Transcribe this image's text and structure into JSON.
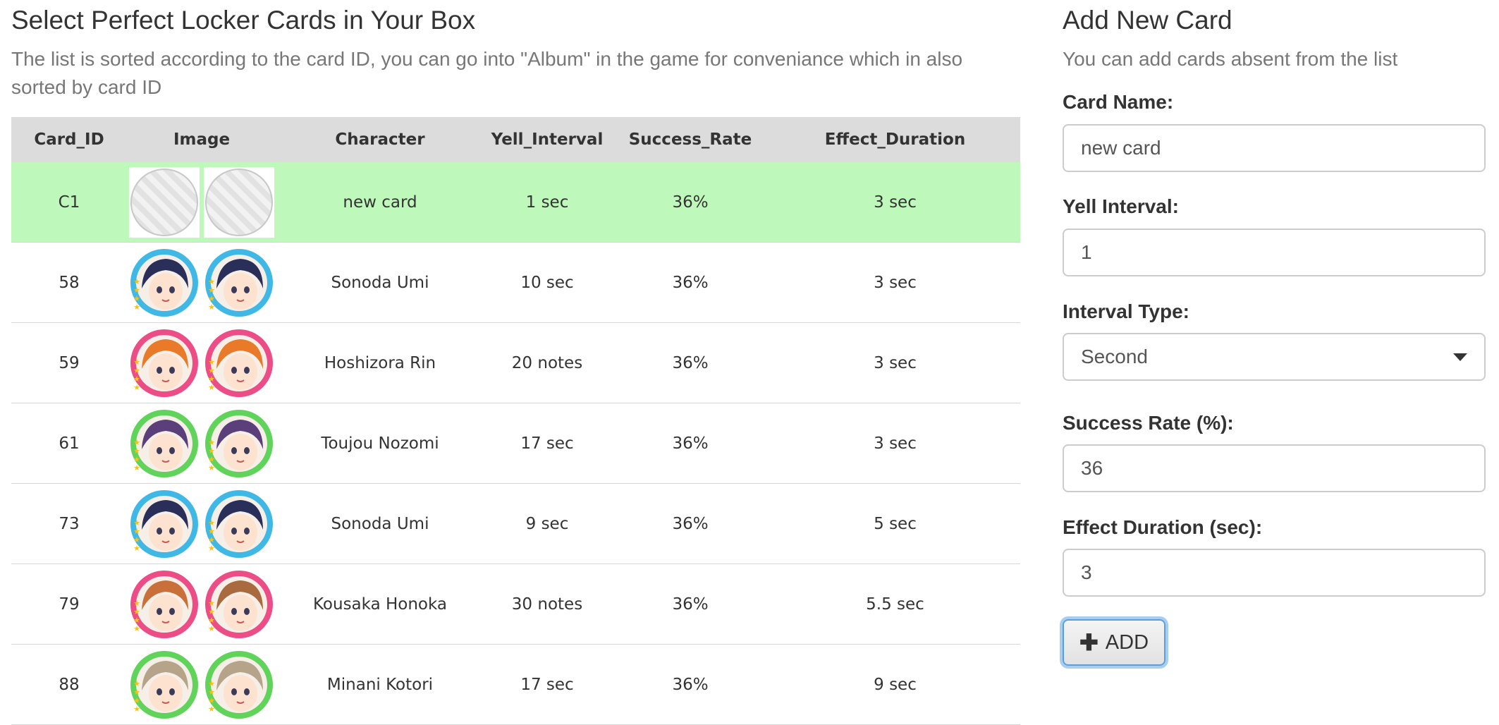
{
  "left": {
    "title": "Select Perfect Locker Cards in Your Box",
    "subtitle": "The list is sorted according to the card ID, you can go into \"Album\" in the game for conveniance which in also sorted by card ID",
    "table": {
      "headers": [
        "Card_ID",
        "Image",
        "Character",
        "Yell_Interval",
        "Success_Rate",
        "Effect_Duration"
      ],
      "rows": [
        {
          "id": "C1",
          "character": "new card",
          "yell_interval": "1 sec",
          "success_rate": "36%",
          "effect_duration": "3 sec",
          "selected": true,
          "avatars": [
            "placeholder",
            "placeholder"
          ]
        },
        {
          "id": "58",
          "character": "Sonoda Umi",
          "yell_interval": "10 sec",
          "success_rate": "36%",
          "effect_duration": "3 sec",
          "avatar_colors": [
            "#3fb8e6",
            "#3fb8e6"
          ],
          "hair_colors": [
            "#2a2f5a",
            "#2a2f5a"
          ]
        },
        {
          "id": "59",
          "character": "Hoshizora Rin",
          "yell_interval": "20 notes",
          "success_rate": "36%",
          "effect_duration": "3 sec",
          "avatar_colors": [
            "#ec4d87",
            "#ec4d87"
          ],
          "hair_colors": [
            "#e87a2a",
            "#e87a2a"
          ]
        },
        {
          "id": "61",
          "character": "Toujou Nozomi",
          "yell_interval": "17 sec",
          "success_rate": "36%",
          "effect_duration": "3 sec",
          "avatar_colors": [
            "#5fd35a",
            "#5fd35a"
          ],
          "hair_colors": [
            "#5a3f7a",
            "#5a3f7a"
          ]
        },
        {
          "id": "73",
          "character": "Sonoda Umi",
          "yell_interval": "9 sec",
          "success_rate": "36%",
          "effect_duration": "5 sec",
          "avatar_colors": [
            "#3fb8e6",
            "#3fb8e6"
          ],
          "hair_colors": [
            "#2a2f5a",
            "#2a2f5a"
          ]
        },
        {
          "id": "79",
          "character": "Kousaka Honoka",
          "yell_interval": "30 notes",
          "success_rate": "36%",
          "effect_duration": "5.5 sec",
          "avatar_colors": [
            "#ec4d87",
            "#ec4d87"
          ],
          "hair_colors": [
            "#c9703a",
            "#a86a3e"
          ]
        },
        {
          "id": "88",
          "character": "Minani Kotori",
          "yell_interval": "17 sec",
          "success_rate": "36%",
          "effect_duration": "9 sec",
          "avatar_colors": [
            "#5fd35a",
            "#5fd35a"
          ],
          "hair_colors": [
            "#b5a48a",
            "#b5a48a"
          ]
        }
      ]
    }
  },
  "right": {
    "title": "Add New Card",
    "subtitle": "You can add cards absent from the list",
    "card_name_label": "Card Name:",
    "card_name_value": "new card",
    "yell_interval_label": "Yell Interval:",
    "yell_interval_value": "1",
    "interval_type_label": "Interval Type:",
    "interval_type_value": "Second",
    "success_rate_label": "Success Rate (%):",
    "success_rate_value": "36",
    "effect_duration_label": "Effect Duration (sec):",
    "effect_duration_value": "3",
    "add_icon": "plus-icon",
    "add_label": "ADD"
  }
}
